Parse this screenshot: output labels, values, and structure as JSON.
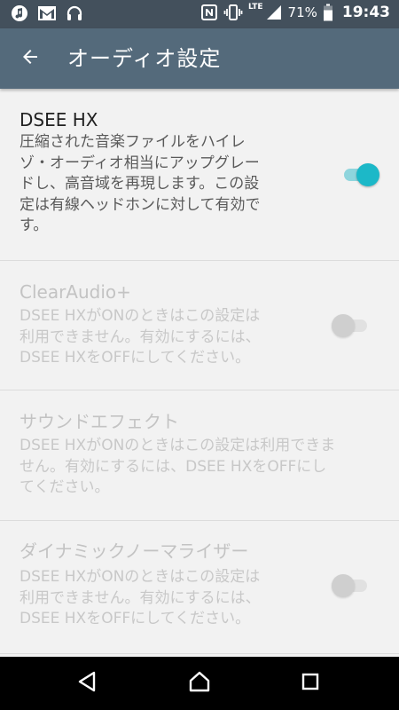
{
  "status_bar": {
    "battery_percent": "71%",
    "network_type": "LTE",
    "time": "19:43",
    "icons": [
      "music-note-icon",
      "gmail-icon",
      "headphones-icon",
      "nfc-icon",
      "vibrate-icon",
      "signal-icon",
      "battery-icon"
    ]
  },
  "app_bar": {
    "title": "オーディオ設定",
    "back_icon": "arrow-back-icon"
  },
  "settings": {
    "dsee_hx": {
      "title": "DSEE HX",
      "summary_lines": [
        "圧縮された音楽ファイルをハイレ",
        "ゾ・オーディオ相当にアップグレー",
        "ドし、高音域を再現します。この設",
        "定は有線ヘッドホンに対して有効で",
        "す。"
      ],
      "enabled": true,
      "checked": true
    },
    "clear_audio": {
      "title": "ClearAudio+",
      "summary_lines": [
        "DSEE HXがONのときはこの設定は",
        "利用できません。有効にするには、",
        "DSEE HXをOFFにしてください。"
      ],
      "enabled": false,
      "checked": false
    },
    "sound_effect": {
      "title": "サウンドエフェクト",
      "summary_lines": [
        "DSEE HXがONのときはこの設定は利用できま",
        "せん。有効にするには、DSEE HXをOFFにし",
        "てください。"
      ],
      "enabled": false
    },
    "dynamic_normalizer": {
      "title": "ダイナミックノーマライザー",
      "summary_lines": [
        "DSEE HXがONのときはこの設定は",
        "利用できません。有効にするには、",
        "DSEE HXをOFFにしてください。"
      ],
      "enabled": false,
      "checked": false
    }
  },
  "nav_bar": {
    "icons": [
      "back-triangle-icon",
      "home-icon",
      "recents-icon"
    ]
  },
  "colors": {
    "status_bar": "#43505c",
    "app_bar": "#546a7b",
    "background": "#f2f2f2",
    "accent": "#1cb8c8",
    "accent_track": "#8fd5dd"
  }
}
